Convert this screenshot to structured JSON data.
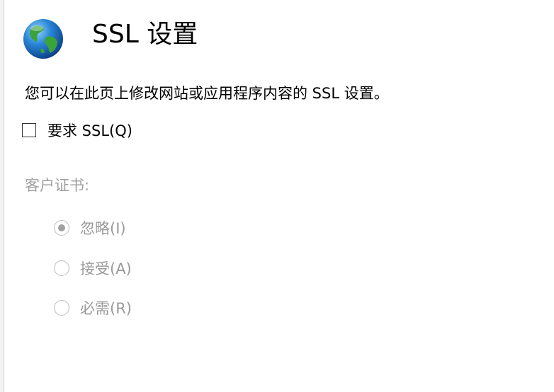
{
  "header": {
    "icon": "globe-icon",
    "title": "SSL 设置"
  },
  "description": "您可以在此页上修改网站或应用程序内容的 SSL 设置。",
  "require_ssl": {
    "label": "要求 SSL(Q)",
    "checked": false
  },
  "client_certificates": {
    "label": "客户证书:",
    "options": [
      {
        "label": "忽略(I)",
        "selected": true
      },
      {
        "label": "接受(A)",
        "selected": false
      },
      {
        "label": "必需(R)",
        "selected": false
      }
    ]
  },
  "colors": {
    "disabled_text": "#9a9a9a",
    "globe_blue": "#1f6fc4",
    "globe_green": "#3aa33a"
  }
}
